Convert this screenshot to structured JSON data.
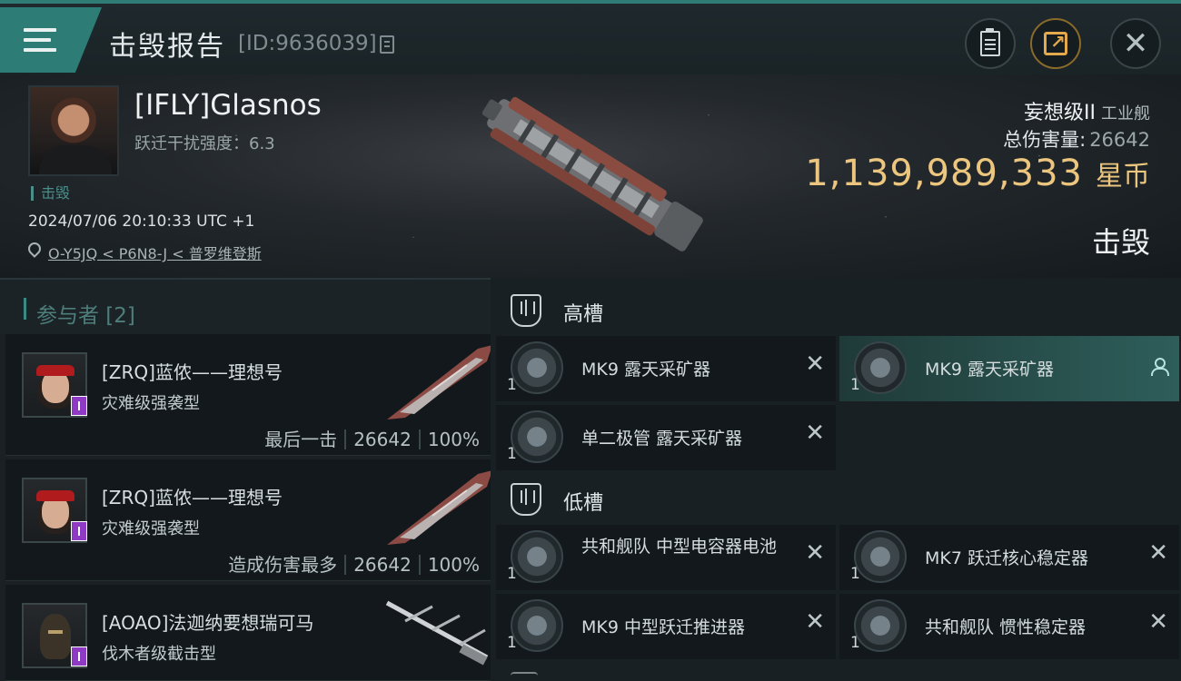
{
  "topbar": {
    "title": "击毁报告",
    "id_text": "[ID:9636039]"
  },
  "victim": {
    "name": "[IFLY]Glasnos",
    "warp_jam_label": "跃迁干扰强度：",
    "warp_jam_value": "6.3",
    "status_tag": "击毁",
    "time": "2024/07/06 20:10:33 UTC +1",
    "location": "O-Y5JQ < P6N8-J < 普罗维登斯"
  },
  "ship": {
    "name": "妄想级II",
    "class": "工业舰",
    "total_damage_label": "总伤害量:",
    "total_damage": "26642",
    "isk_value": "1,139,989,333",
    "isk_unit": "星币",
    "result": "击毁"
  },
  "participants": {
    "title": "参与者 [2]",
    "items": [
      {
        "name": "[ZRQ]蓝侬——理想号",
        "ship": "灾难级强袭型",
        "role": "最后一击",
        "damage": "26642",
        "percent": "100%"
      },
      {
        "name": "[ZRQ]蓝侬——理想号",
        "ship": "灾难级强袭型",
        "role": "造成伤害最多",
        "damage": "26642",
        "percent": "100%"
      },
      {
        "name": "[AOAO]法迦纳要想瑞可马",
        "ship": "伐木者级截击型"
      }
    ]
  },
  "fitting": {
    "high_slot_label": "高槽",
    "low_slot_label": "低槽",
    "high": [
      {
        "name": "MK9 露天采矿器",
        "qty": "1"
      },
      {
        "name": "MK9 露天采矿器",
        "qty": "1"
      },
      {
        "name": "单二极管 露天采矿器",
        "qty": "1"
      }
    ],
    "low": [
      {
        "name": "共和舰队 中型电容器电池",
        "qty": "1"
      },
      {
        "name": "MK7 跃迁核心稳定器",
        "qty": "1"
      },
      {
        "name": "MK9 中型跃迁推进器",
        "qty": "1"
      },
      {
        "name": "共和舰队 惯性稳定器",
        "qty": "1"
      }
    ]
  },
  "colors": {
    "accent": "#2d7d76",
    "isk_gold": "#ecc67e",
    "badge_red": "#d21f22",
    "badge_purple": "#8e3ac4"
  },
  "icons": [
    "menu-icon",
    "copy-icon",
    "clipboard-icon",
    "share-icon",
    "close-icon",
    "location-icon",
    "high-slot-icon",
    "low-slot-icon",
    "remove-icon",
    "person-icon"
  ]
}
